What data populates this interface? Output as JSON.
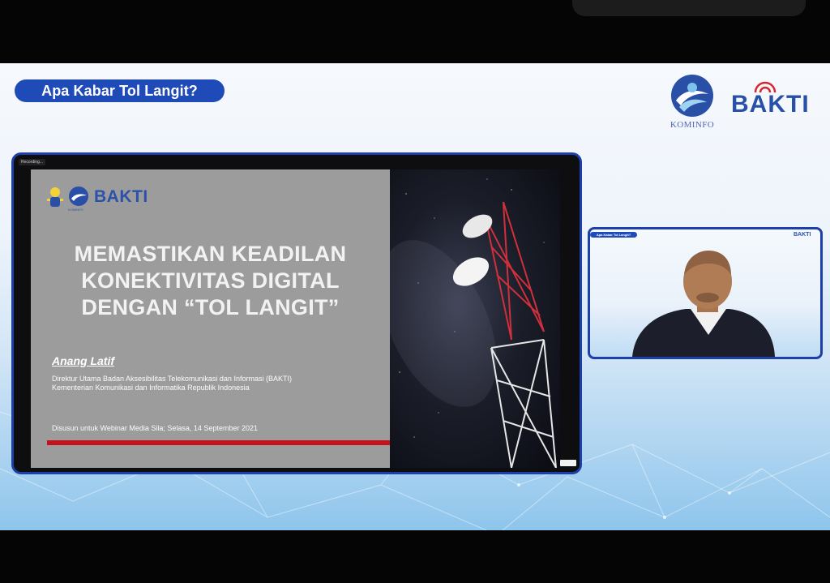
{
  "header": {
    "title_pill": "Apa Kabar Tol Langit?"
  },
  "logos": {
    "kominfo": "KOMINFO",
    "bakti": "BAKTI"
  },
  "presentation": {
    "recording_label": "Recording...",
    "title_lines": [
      "MEMASTIKAN KEADILAN",
      "KONEKTIVITAS DIGITAL",
      "DENGAN “TOL LANGIT”"
    ],
    "speaker_name": "Anang Latif",
    "speaker_desc_lines": [
      "Direktur Utama Badan Aksesibilitas Telekomunikasi dan Informasi (BAKTI)",
      "Kementerian Komunikasi dan Informatika Republik Indonesia"
    ],
    "footer": "Disusun untuk Webinar Media Sila; Selasa, 14 September 2021",
    "slide_logo_bakti": "BAKTI",
    "slide_logo_kominfo": "KOMINFO"
  },
  "speaker_video": {
    "mini_title": "Apa Kabar Tol Langit?",
    "mini_logo": "BAKTI"
  },
  "colors": {
    "brand_blue": "#1f4bb8",
    "accent_red": "#c4121c",
    "slide_gray": "#9c9c9c"
  }
}
